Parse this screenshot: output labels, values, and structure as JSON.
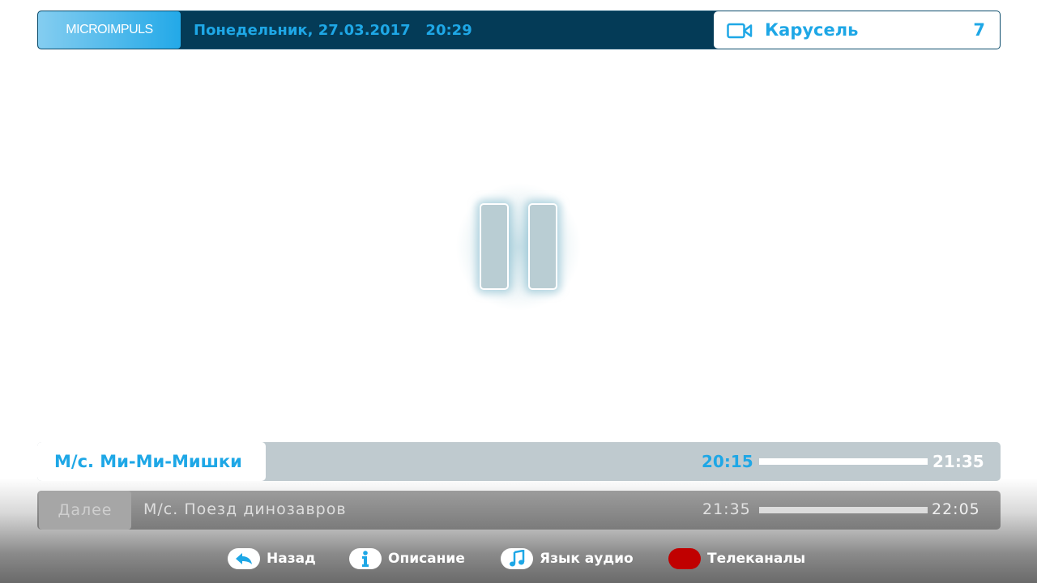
{
  "header": {
    "brand": "MICROIMPULS",
    "datetime": "Понедельник, 27.03.2017   20:29",
    "channel_name": "Карусель",
    "channel_number": "7"
  },
  "current_program": {
    "title": "М/с. Ми-Ми-Мишки",
    "start": "20:15",
    "end": "21:35"
  },
  "next_program": {
    "label": "Далее",
    "title": "М/с. Поезд динозавров",
    "start": "21:35",
    "end": "22:05"
  },
  "hints": [
    {
      "icon": "back-arrow-icon",
      "label": "Назад"
    },
    {
      "icon": "info-icon",
      "label": "Описание"
    },
    {
      "icon": "music-note-icon",
      "label": "Язык аудио"
    },
    {
      "icon": "red-button-icon",
      "label": "Телеканалы"
    }
  ],
  "colors": {
    "accent": "#1ea7e6",
    "header_bg": "#043b57",
    "red_key": "#c00000"
  }
}
